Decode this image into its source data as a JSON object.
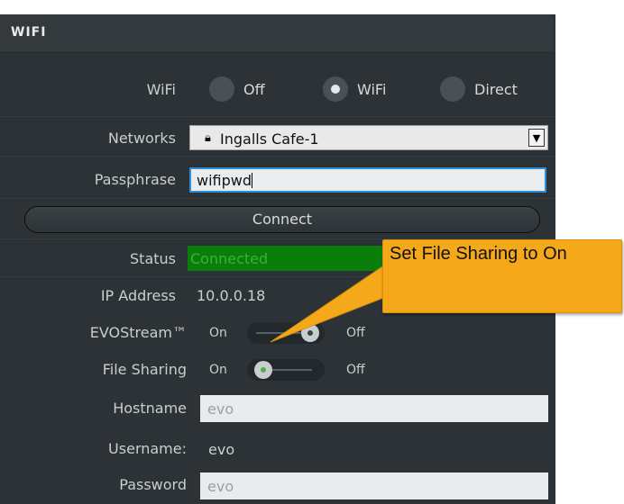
{
  "window": {
    "title": "WIFI"
  },
  "wifi_mode": {
    "label": "WiFi",
    "options": [
      {
        "label": "Off",
        "checked": false
      },
      {
        "label": "WiFi",
        "checked": true
      },
      {
        "label": "Direct",
        "checked": false
      }
    ]
  },
  "networks": {
    "label": "Networks",
    "value": "Ingalls Cafe-1",
    "icon": "lock-icon"
  },
  "passphrase": {
    "label": "Passphrase",
    "value": "wifipwd"
  },
  "connect_button": {
    "label": "Connect"
  },
  "status": {
    "label": "Status",
    "value": "Connected",
    "color": "#0b7d0b"
  },
  "ip_address": {
    "label": "IP Address",
    "value": "10.0.0.18"
  },
  "evostream": {
    "label": "EVOStream™",
    "on_label": "On",
    "off_label": "Off",
    "state": "off"
  },
  "file_sharing": {
    "label": "File Sharing",
    "on_label": "On",
    "off_label": "Off",
    "state": "on"
  },
  "hostname": {
    "label": "Hostname",
    "value": "evo"
  },
  "username": {
    "label": "Username:",
    "value": "evo"
  },
  "password": {
    "label": "Password",
    "value": "evo"
  },
  "callout": {
    "text": "Set File Sharing to On",
    "color": "#f5a81a"
  }
}
